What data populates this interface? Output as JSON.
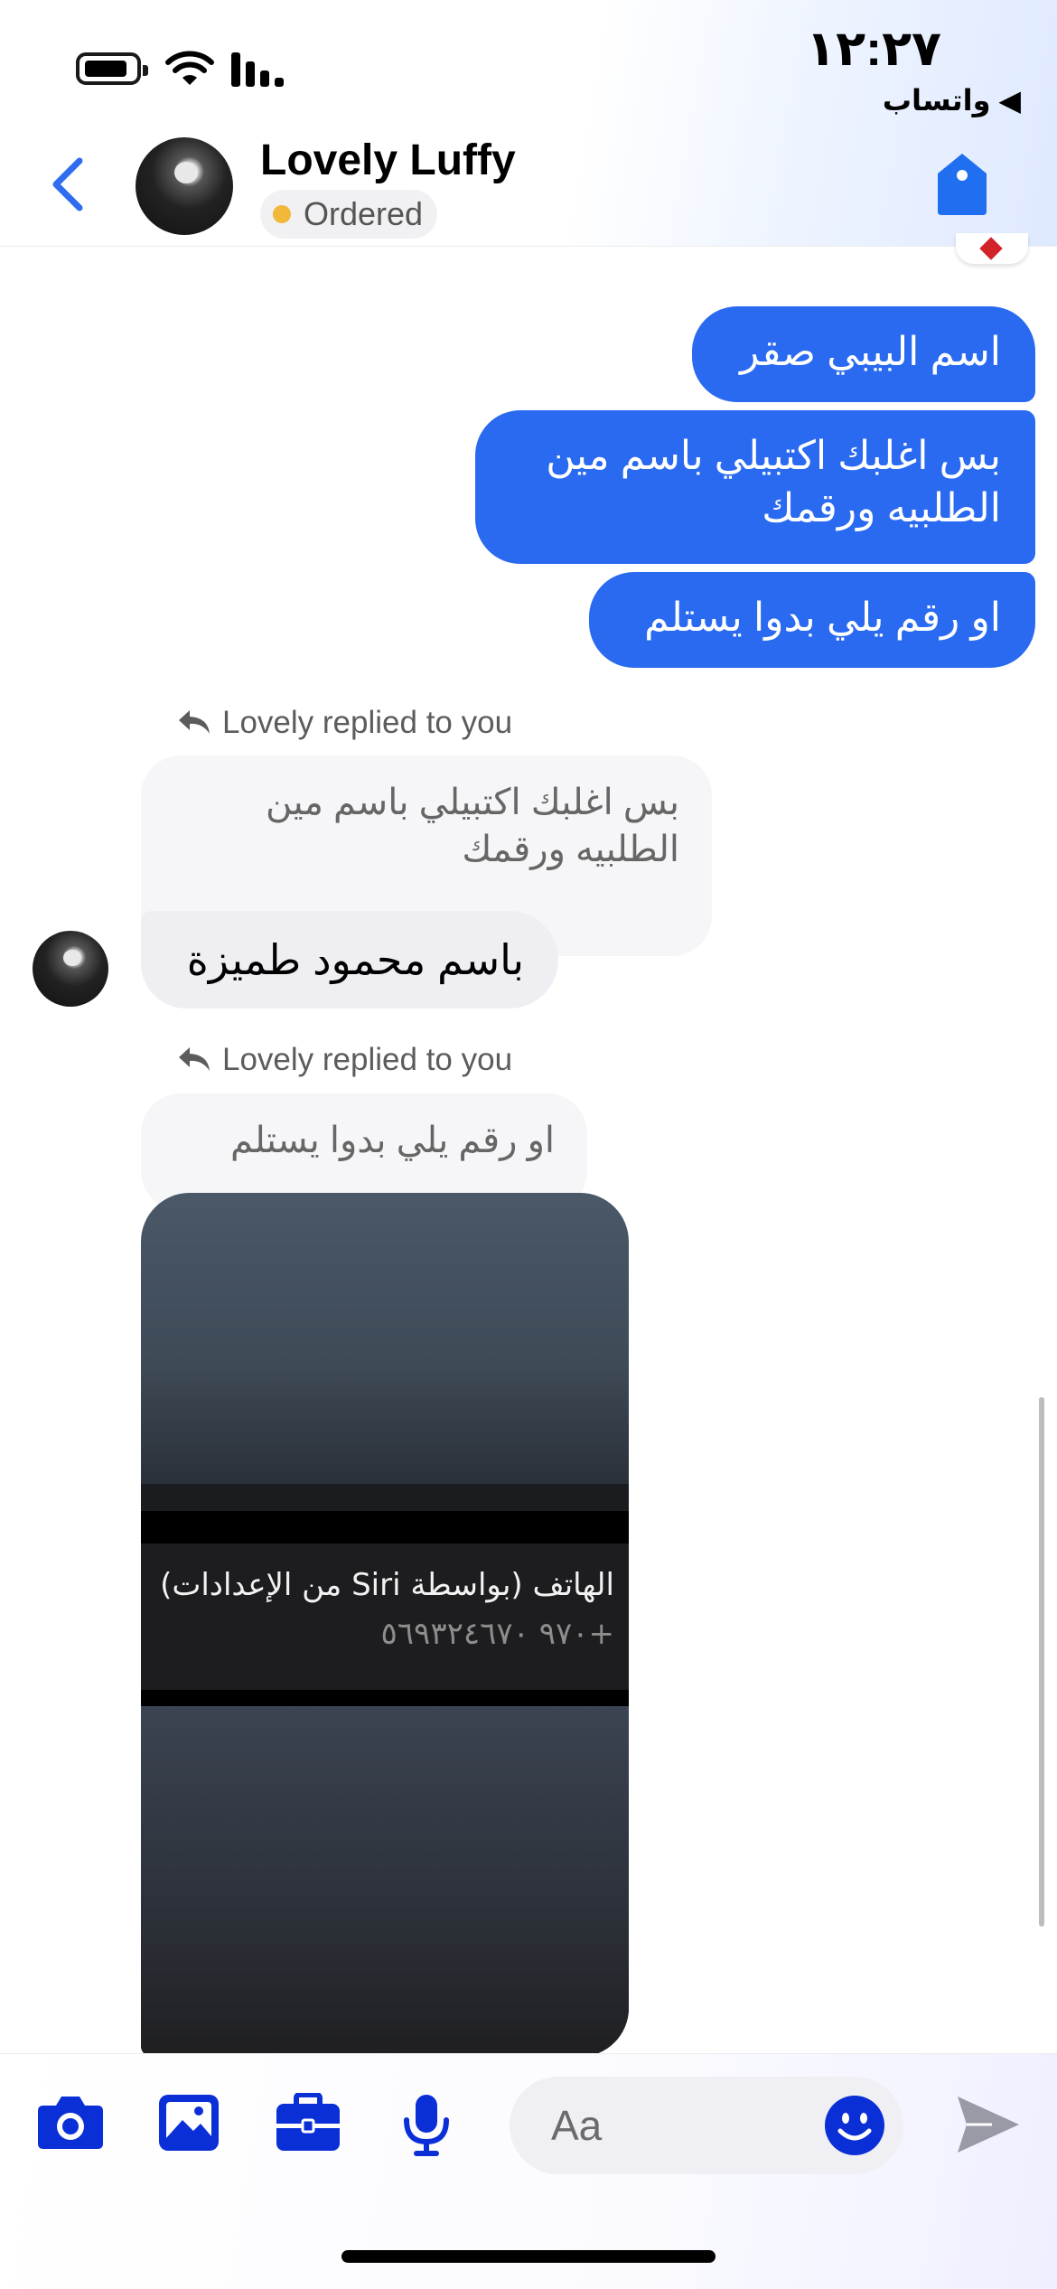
{
  "status_bar": {
    "time": "١٢:٢٧",
    "back_app": "◀ واتساب"
  },
  "header": {
    "contact_name": "Lovely Luffy",
    "status": "Ordered",
    "status_color": "#f2b83a"
  },
  "messages": {
    "outgoing": [
      "اسم البيبي صقر",
      "بس اغلبك اكتبيلي باسم مين الطلبيه ورقمك",
      "او رقم يلي بدوا يستلم"
    ],
    "reply_1": {
      "label": "Lovely replied to you",
      "quoted": "بس اغلبك اكتبيلي باسم مين الطلبيه ورقمك",
      "text": "باسم محمود طميزة"
    },
    "reply_2": {
      "label": "Lovely replied to you",
      "quoted": "او رقم يلي بدوا يستلم",
      "image_text_line1": "الهاتف (بواسطة Siri من الإعدادات)",
      "image_text_line2": "+٩٧٠ ٥٦٩٣٢٤٦٧٠"
    }
  },
  "composer": {
    "placeholder": "Aa",
    "accent": "#0a2fd6"
  },
  "colors": {
    "outgoing_bubble": "#2a6af0",
    "back_icon": "#2f6cf0",
    "tag_icon": "#1f6ff0"
  }
}
